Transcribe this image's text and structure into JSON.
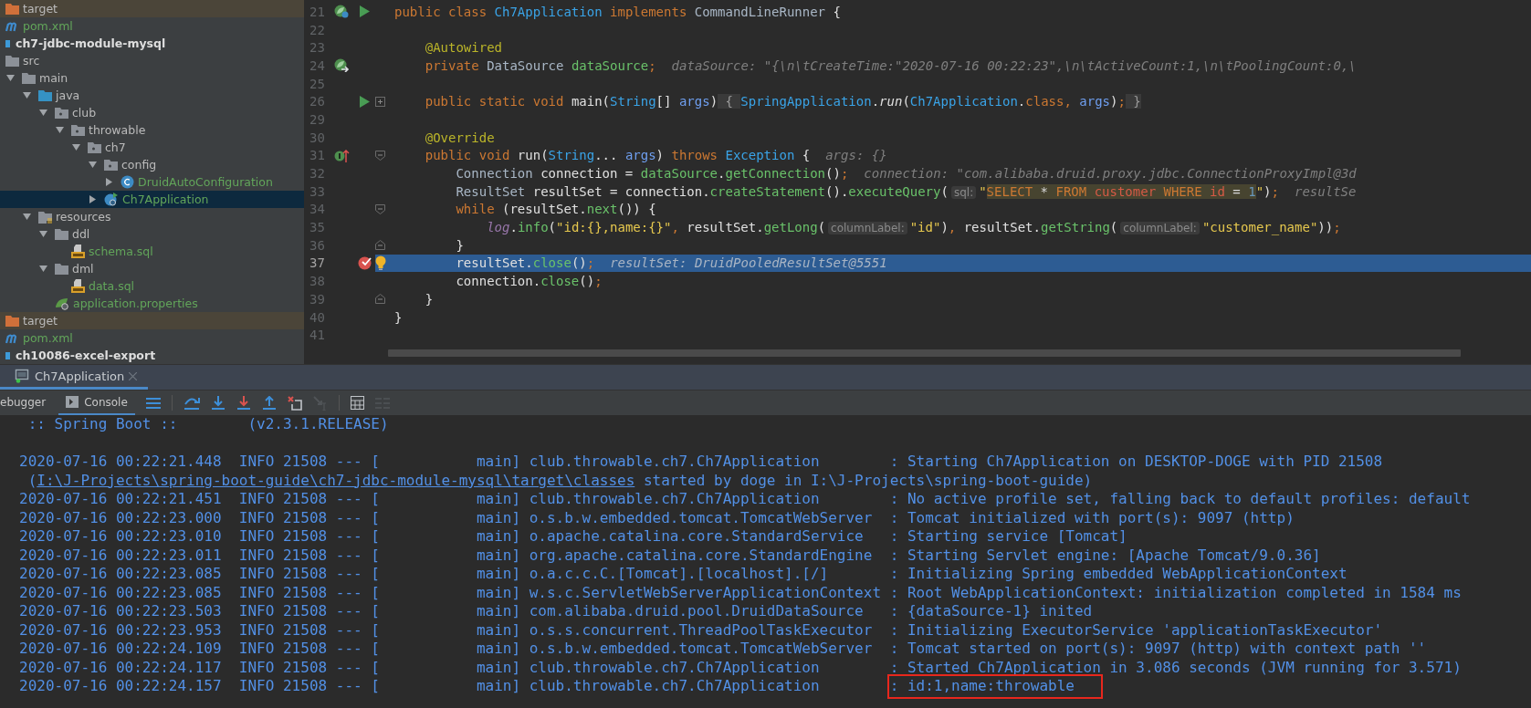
{
  "project_tree": {
    "items": [
      {
        "label": "target",
        "kind": "excluded-folder",
        "selected": false
      },
      {
        "label": "pom.xml",
        "kind": "maven",
        "selected": false
      },
      {
        "label": "ch7-jdbc-module-mysql",
        "kind": "module",
        "selected": false,
        "children": [
          {
            "label": "src",
            "kind": "folder",
            "selected": false,
            "children": [
              {
                "label": "main",
                "kind": "folder",
                "expanded": true,
                "selected": false,
                "children": [
                  {
                    "label": "java",
                    "kind": "source-folder",
                    "expanded": true,
                    "selected": false,
                    "children": [
                      {
                        "label": "club",
                        "kind": "package",
                        "expanded": true,
                        "selected": false,
                        "children": [
                          {
                            "label": "throwable",
                            "kind": "package",
                            "expanded": true,
                            "selected": false,
                            "children": [
                              {
                                "label": "ch7",
                                "kind": "package",
                                "expanded": true,
                                "selected": false,
                                "children": [
                                  {
                                    "label": "config",
                                    "kind": "package",
                                    "expanded": true,
                                    "selected": false,
                                    "children": [
                                      {
                                        "label": "DruidAutoConfiguration",
                                        "kind": "class",
                                        "expanded": false,
                                        "selected": false
                                      }
                                    ]
                                  },
                                  {
                                    "label": "Ch7Application",
                                    "kind": "app-class",
                                    "expanded": false,
                                    "selected": true
                                  }
                                ]
                              }
                            ]
                          }
                        ]
                      }
                    ]
                  },
                  {
                    "label": "resources",
                    "kind": "resources-folder",
                    "expanded": true,
                    "selected": false,
                    "children": [
                      {
                        "label": "ddl",
                        "kind": "folder",
                        "expanded": true,
                        "selected": false,
                        "children": [
                          {
                            "label": "schema.sql",
                            "kind": "sql",
                            "selected": false
                          }
                        ]
                      },
                      {
                        "label": "dml",
                        "kind": "folder",
                        "expanded": true,
                        "selected": false,
                        "children": [
                          {
                            "label": "data.sql",
                            "kind": "sql",
                            "selected": false
                          }
                        ]
                      },
                      {
                        "label": "application.properties",
                        "kind": "properties",
                        "selected": false
                      }
                    ]
                  }
                ]
              }
            ]
          },
          {
            "label": "target",
            "kind": "excluded-folder",
            "selected": false
          },
          {
            "label": "pom.xml",
            "kind": "maven",
            "selected": false
          }
        ]
      },
      {
        "label": "ch10086-excel-export",
        "kind": "module",
        "selected": false
      }
    ]
  },
  "editor": {
    "lines": [
      {
        "number": "21",
        "current": false,
        "gutter": [
          {
            "kind": "bean"
          },
          {
            "kind": "run"
          }
        ],
        "tokens": [
          {
            "kind": "keyword",
            "text": "public class "
          },
          {
            "kind": "class",
            "text": "Ch7Application"
          },
          {
            "kind": "keyword",
            "text": " implements "
          },
          {
            "kind": "type",
            "text": "CommandLineRunner"
          },
          {
            "kind": "plain",
            "text": " {"
          }
        ]
      },
      {
        "number": "22",
        "current": false
      },
      {
        "number": "23",
        "current": false,
        "tokens": [
          {
            "kind": "annotation",
            "text": "    @Autowired"
          }
        ]
      },
      {
        "number": "24",
        "current": false,
        "gutter": [
          {
            "kind": "bean-inject"
          }
        ],
        "tokens": [
          {
            "kind": "keyword",
            "text": "    private "
          },
          {
            "kind": "type",
            "text": "DataSource "
          },
          {
            "kind": "member",
            "text": "dataSource"
          },
          {
            "kind": "keyword",
            "text": ";"
          }
        ],
        "debug": "dataSource: \"{\\n\\tCreateTime:\"2020-07-16 00:22:23\",\\n\\tActiveCount:1,\\n\\tPoolingCount:0,\\"
      },
      {
        "number": "25",
        "current": false
      },
      {
        "number": "26",
        "current": false,
        "gutter": [
          {
            "kind": "run"
          },
          {
            "kind": "fold-collapsed"
          }
        ],
        "tokens": [
          {
            "kind": "keyword",
            "text": "    public static void "
          },
          {
            "kind": "plain",
            "text": "main("
          },
          {
            "kind": "class",
            "text": "String"
          },
          {
            "kind": "plain",
            "text": "[] "
          },
          {
            "kind": "param",
            "text": "args"
          },
          {
            "kind": "plain",
            "text": ")"
          },
          {
            "kind": "fold",
            "text": " { "
          },
          {
            "kind": "class",
            "text": "SpringApplication"
          },
          {
            "kind": "plain",
            "text": "."
          },
          {
            "kind": "static",
            "text": "run"
          },
          {
            "kind": "plain",
            "text": "("
          },
          {
            "kind": "class",
            "text": "Ch7Application"
          },
          {
            "kind": "plain",
            "text": "."
          },
          {
            "kind": "keyword",
            "text": "class, "
          },
          {
            "kind": "param",
            "text": "args"
          },
          {
            "kind": "plain",
            "text": ")"
          },
          {
            "kind": "keyword",
            "text": ";"
          },
          {
            "kind": "fold",
            "text": " }"
          }
        ]
      },
      {
        "number": "29",
        "current": false
      },
      {
        "number": "30",
        "current": false,
        "tokens": [
          {
            "kind": "annotation",
            "text": "    @Override"
          }
        ]
      },
      {
        "number": "31",
        "current": false,
        "gutter": [
          {
            "kind": "override"
          },
          {
            "kind": "fold-start"
          }
        ],
        "tokens": [
          {
            "kind": "keyword",
            "text": "    public void "
          },
          {
            "kind": "plain",
            "text": "run("
          },
          {
            "kind": "class",
            "text": "String"
          },
          {
            "kind": "plain",
            "text": "... "
          },
          {
            "kind": "param",
            "text": "args"
          },
          {
            "kind": "plain",
            "text": ") "
          },
          {
            "kind": "keyword",
            "text": "throws "
          },
          {
            "kind": "class",
            "text": "Exception"
          },
          {
            "kind": "plain",
            "text": " {"
          }
        ],
        "debug": "args: {}"
      },
      {
        "number": "32",
        "current": false,
        "tokens": [
          {
            "kind": "type",
            "text": "        Connection "
          },
          {
            "kind": "plain",
            "text": "connection = "
          },
          {
            "kind": "member",
            "text": "dataSource"
          },
          {
            "kind": "plain",
            "text": "."
          },
          {
            "kind": "method",
            "text": "getConnection"
          },
          {
            "kind": "plain",
            "text": "()"
          },
          {
            "kind": "keyword",
            "text": ";"
          }
        ],
        "debug": "connection: \"com.alibaba.druid.proxy.jdbc.ConnectionProxyImpl@3d"
      },
      {
        "number": "33",
        "current": false,
        "tokens": [
          {
            "kind": "type",
            "text": "        ResultSet "
          },
          {
            "kind": "plain",
            "text": "resultSet = connection."
          },
          {
            "kind": "method",
            "text": "createStatement"
          },
          {
            "kind": "plain",
            "text": "()."
          },
          {
            "kind": "method",
            "text": "executeQuery"
          },
          {
            "kind": "plain",
            "text": "("
          },
          {
            "kind": "hint",
            "text": "sql:"
          },
          {
            "kind": "string",
            "text": "\""
          },
          {
            "kind": "sql-keyword",
            "text": "SELECT"
          },
          {
            "kind": "sql-op",
            "text": " * "
          },
          {
            "kind": "sql-keyword",
            "text": "FROM "
          },
          {
            "kind": "sql-name",
            "text": "customer "
          },
          {
            "kind": "sql-keyword",
            "text": "WHERE "
          },
          {
            "kind": "sql-name",
            "text": "id"
          },
          {
            "kind": "sql-op",
            "text": " = "
          },
          {
            "kind": "sql-number",
            "text": "1"
          },
          {
            "kind": "string",
            "text": "\""
          },
          {
            "kind": "plain",
            "text": ")"
          },
          {
            "kind": "keyword",
            "text": ";"
          }
        ],
        "debug": "resultSe"
      },
      {
        "number": "34",
        "current": false,
        "gutter": [
          {
            "kind": "fold-start"
          }
        ],
        "tokens": [
          {
            "kind": "keyword",
            "text": "        while "
          },
          {
            "kind": "plain",
            "text": "(resultSet."
          },
          {
            "kind": "method",
            "text": "next"
          },
          {
            "kind": "plain",
            "text": "()) {"
          }
        ]
      },
      {
        "number": "35",
        "current": false,
        "tokens": [
          {
            "kind": "log",
            "text": "            log"
          },
          {
            "kind": "plain",
            "text": "."
          },
          {
            "kind": "method",
            "text": "info"
          },
          {
            "kind": "plain",
            "text": "("
          },
          {
            "kind": "string",
            "text": "\"id:{},name:{}\""
          },
          {
            "kind": "keyword",
            "text": ", "
          },
          {
            "kind": "plain",
            "text": "resultSet."
          },
          {
            "kind": "method",
            "text": "getLong"
          },
          {
            "kind": "plain",
            "text": "("
          },
          {
            "kind": "hint",
            "text": "columnLabel:"
          },
          {
            "kind": "string",
            "text": "\"id\""
          },
          {
            "kind": "plain",
            "text": ")"
          },
          {
            "kind": "keyword",
            "text": ", "
          },
          {
            "kind": "plain",
            "text": "resultSet."
          },
          {
            "kind": "method",
            "text": "getString"
          },
          {
            "kind": "plain",
            "text": "("
          },
          {
            "kind": "hint",
            "text": "columnLabel:"
          },
          {
            "kind": "string",
            "text": "\"customer_name\""
          },
          {
            "kind": "plain",
            "text": "))"
          },
          {
            "kind": "keyword",
            "text": ";"
          }
        ]
      },
      {
        "number": "36",
        "current": false,
        "gutter": [
          {
            "kind": "fold-end"
          }
        ],
        "tokens": [
          {
            "kind": "plain",
            "text": "        }"
          }
        ]
      },
      {
        "number": "37",
        "current": true,
        "gutter": [
          {
            "kind": "breakpoint"
          },
          {
            "kind": "bulb"
          }
        ],
        "tokens": [
          {
            "kind": "plain",
            "text": "        resultSet."
          },
          {
            "kind": "method",
            "text": "close"
          },
          {
            "kind": "plain",
            "text": "()"
          },
          {
            "kind": "keyword",
            "text": ";"
          }
        ],
        "debug": "resultSet: DruidPooledResultSet@5551"
      },
      {
        "number": "38",
        "current": false,
        "tokens": [
          {
            "kind": "plain",
            "text": "        connection."
          },
          {
            "kind": "method",
            "text": "close"
          },
          {
            "kind": "plain",
            "text": "()"
          },
          {
            "kind": "keyword",
            "text": ";"
          }
        ]
      },
      {
        "number": "39",
        "current": false,
        "gutter": [
          {
            "kind": "fold-end"
          }
        ],
        "tokens": [
          {
            "kind": "plain",
            "text": "    }"
          }
        ]
      },
      {
        "number": "40",
        "current": false,
        "tokens": [
          {
            "kind": "plain",
            "text": "}"
          }
        ]
      },
      {
        "number": "41",
        "current": false
      }
    ]
  },
  "run_tabs": [
    {
      "label": "Ch7Application",
      "selected": true
    }
  ],
  "debug_toolbar": {
    "tabs": [
      {
        "label": "ebugger",
        "kind": "debugger",
        "selected": false
      },
      {
        "label": "Console",
        "kind": "console",
        "selected": true
      }
    ],
    "buttons": [
      {
        "kind": "menu",
        "disabled": false
      },
      {
        "kind": "step-over",
        "disabled": false
      },
      {
        "kind": "step-into",
        "disabled": false
      },
      {
        "kind": "force-step-into",
        "disabled": false
      },
      {
        "kind": "step-out",
        "disabled": false
      },
      {
        "kind": "drop-frame",
        "disabled": false
      },
      {
        "kind": "run-to-cursor",
        "disabled": true
      },
      {
        "kind": "evaluate",
        "disabled": false
      },
      {
        "kind": "trace",
        "disabled": true
      }
    ]
  },
  "console": {
    "lines": [
      {
        "kind": "banner",
        "text": " :: Spring Boot ::        (v2.3.1.RELEASE)"
      },
      {
        "kind": "log",
        "text": "2020-07-16 00:22:21.448  INFO 21508 --- [           main] club.throwable.ch7.Ch7Application        : Starting Ch7Application on DESKTOP-DOGE with PID 21508"
      },
      {
        "kind": "wrap",
        "before": " (",
        "link": "I:\\J-Projects\\spring-boot-guide\\ch7-jdbc-module-mysql\\target\\classes",
        "after": " started by doge in I:\\J-Projects\\spring-boot-guide)"
      },
      {
        "kind": "log",
        "text": "2020-07-16 00:22:21.451  INFO 21508 --- [           main] club.throwable.ch7.Ch7Application        : No active profile set, falling back to default profiles: default"
      },
      {
        "kind": "log",
        "text": "2020-07-16 00:22:23.000  INFO 21508 --- [           main] o.s.b.w.embedded.tomcat.TomcatWebServer  : Tomcat initialized with port(s): 9097 (http)"
      },
      {
        "kind": "log",
        "text": "2020-07-16 00:22:23.010  INFO 21508 --- [           main] o.apache.catalina.core.StandardService   : Starting service [Tomcat]"
      },
      {
        "kind": "log",
        "text": "2020-07-16 00:22:23.011  INFO 21508 --- [           main] org.apache.catalina.core.StandardEngine  : Starting Servlet engine: [Apache Tomcat/9.0.36]"
      },
      {
        "kind": "log",
        "text": "2020-07-16 00:22:23.085  INFO 21508 --- [           main] o.a.c.c.C.[Tomcat].[localhost].[/]       : Initializing Spring embedded WebApplicationContext"
      },
      {
        "kind": "log",
        "text": "2020-07-16 00:22:23.085  INFO 21508 --- [           main] w.s.c.ServletWebServerApplicationContext : Root WebApplicationContext: initialization completed in 1584 ms"
      },
      {
        "kind": "log",
        "text": "2020-07-16 00:22:23.503  INFO 21508 --- [           main] com.alibaba.druid.pool.DruidDataSource   : {dataSource-1} inited"
      },
      {
        "kind": "log",
        "text": "2020-07-16 00:22:23.953  INFO 21508 --- [           main] o.s.s.concurrent.ThreadPoolTaskExecutor  : Initializing ExecutorService 'applicationTaskExecutor'"
      },
      {
        "kind": "log",
        "text": "2020-07-16 00:22:24.109  INFO 21508 --- [           main] o.s.b.w.embedded.tomcat.TomcatWebServer  : Tomcat started on port(s): 9097 (http) with context path ''"
      },
      {
        "kind": "log",
        "text": "2020-07-16 00:22:24.117  INFO 21508 --- [           main] club.throwable.ch7.Ch7Application        : Started Ch7Application in 3.086 seconds (JVM running for 3.571)"
      },
      {
        "kind": "boxed",
        "text": "2020-07-16 00:22:24.157  INFO 21508 --- [           main] club.throwable.ch7.Ch7Application        ",
        "boxed_text": ": id:1,name:throwable"
      }
    ]
  }
}
